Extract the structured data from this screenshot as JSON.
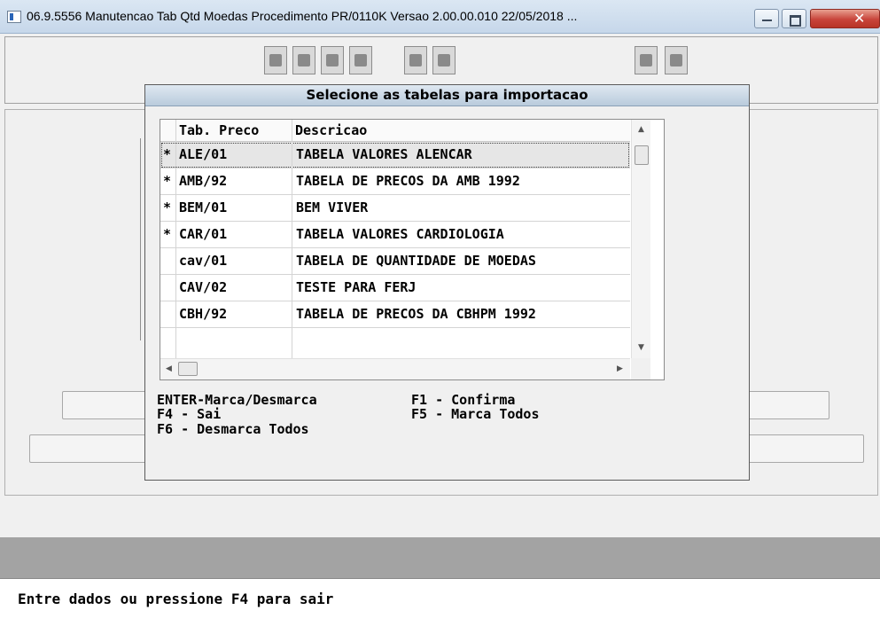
{
  "window": {
    "title": "06.9.5556 Manutencao  Tab Qtd Moedas Procedimento PR/0110K Versao 2.00.00.010 22/05/2018 ...",
    "close_glyph": "✕"
  },
  "dialog": {
    "title": "Selecione as tabelas para importacao",
    "columns": {
      "code": "Tab. Preco",
      "desc": "Descricao"
    },
    "rows": [
      {
        "mark": "*",
        "code": "ALE/01",
        "desc": "TABELA VALORES ALENCAR"
      },
      {
        "mark": "*",
        "code": "AMB/92",
        "desc": "TABELA DE PRECOS DA AMB 1992"
      },
      {
        "mark": "*",
        "code": "BEM/01",
        "desc": "BEM VIVER"
      },
      {
        "mark": "*",
        "code": "CAR/01",
        "desc": "TABELA VALORES CARDIOLOGIA"
      },
      {
        "mark": "",
        "code": "cav/01",
        "desc": "TABELA DE QUANTIDADE DE MOEDAS"
      },
      {
        "mark": "",
        "code": "CAV/02",
        "desc": "TESTE PARA FERJ"
      },
      {
        "mark": "",
        "code": "CBH/92",
        "desc": "TABELA DE PRECOS DA CBHPM 1992"
      },
      {
        "mark": "",
        "code": "",
        "desc": ""
      }
    ],
    "keys": {
      "enter": "ENTER-Marca/Desmarca",
      "f1": "F1 - Confirma",
      "f4": "F4 - Sai",
      "f5": "F5 - Marca Todos",
      "f6": "F6 - Desmarca Todos"
    }
  },
  "status": {
    "message": "Entre dados ou pressione F4 para sair"
  },
  "colors": {
    "statusbar": "#a3a3a3",
    "titlebar": "#c6d7ea",
    "close_button": "#c8443a"
  },
  "icons": [
    "app-icon",
    "minimize-icon",
    "maximize-icon",
    "close-icon",
    "scroll-up-icon",
    "scroll-down-icon",
    "scroll-left-icon",
    "scroll-right-icon"
  ]
}
